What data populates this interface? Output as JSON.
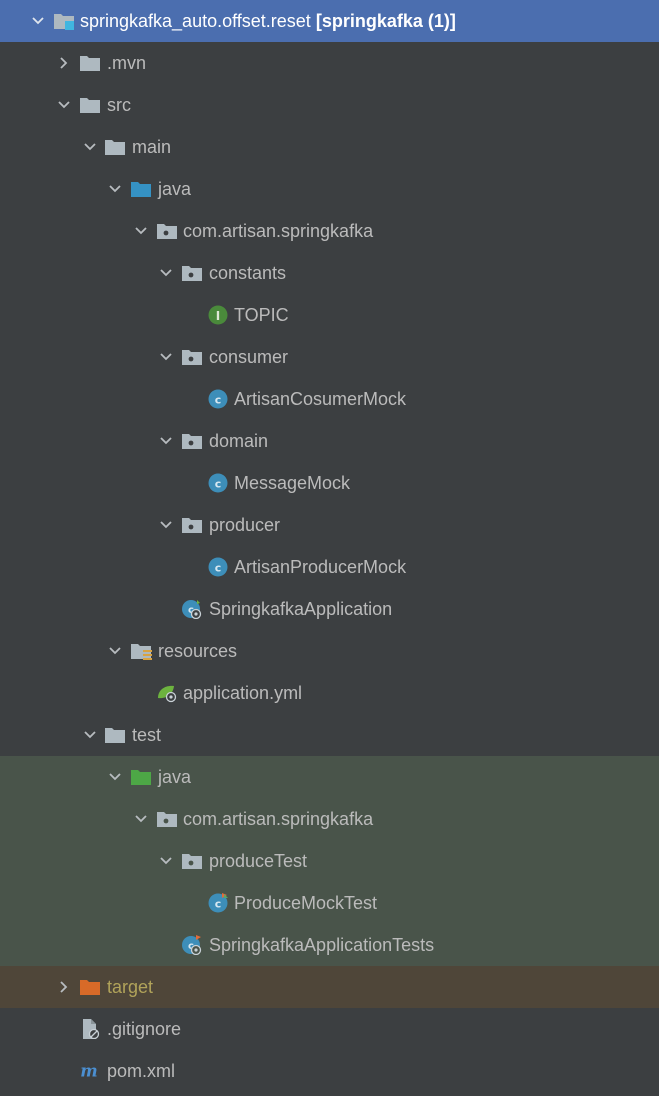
{
  "colors": {
    "selected_bg": "#4b6eaf",
    "panel_bg": "#3c3f41",
    "test_bg": "#49544a",
    "excluded_bg": "#4f4639",
    "folder_grey": "#aeb9c0",
    "folder_java_blue": "#3592c4",
    "folder_test_green": "#4da746",
    "folder_excluded_orange": "#d86a28",
    "class_icon": "#3d8eb9",
    "interface_icon": "#4a8a3b",
    "spring_green": "#6db33f",
    "maven_blue": "#4b8fd1"
  },
  "tree": {
    "root": {
      "name": "springkafka_auto.offset.reset",
      "suffix": "[springkafka (1)]",
      "icon": "module-folder-icon"
    },
    "mvn": {
      "name": ".mvn",
      "icon": "folder-icon"
    },
    "src": {
      "name": "src",
      "icon": "folder-icon"
    },
    "main": {
      "name": "main",
      "icon": "folder-icon"
    },
    "main_java": {
      "name": "java",
      "icon": "source-root-folder-icon"
    },
    "main_pkg": {
      "name": "com.artisan.springkafka",
      "icon": "package-icon"
    },
    "constants": {
      "name": "constants",
      "icon": "package-icon"
    },
    "topic": {
      "name": "TOPIC",
      "icon": "interface-icon"
    },
    "consumer": {
      "name": "consumer",
      "icon": "package-icon"
    },
    "consumer_class": {
      "name": "ArtisanCosumerMock",
      "icon": "class-icon"
    },
    "domain": {
      "name": "domain",
      "icon": "package-icon"
    },
    "domain_class": {
      "name": "MessageMock",
      "icon": "class-icon"
    },
    "producer": {
      "name": "producer",
      "icon": "package-icon"
    },
    "producer_class": {
      "name": "ArtisanProducerMock",
      "icon": "class-icon"
    },
    "app": {
      "name": "SpringkafkaApplication",
      "icon": "spring-boot-class-icon"
    },
    "resources": {
      "name": "resources",
      "icon": "resources-folder-icon"
    },
    "app_yml": {
      "name": "application.yml",
      "icon": "spring-config-icon"
    },
    "test": {
      "name": "test",
      "icon": "folder-icon"
    },
    "test_java": {
      "name": "java",
      "icon": "test-root-folder-icon"
    },
    "test_pkg": {
      "name": "com.artisan.springkafka",
      "icon": "package-icon"
    },
    "produce_test": {
      "name": "produceTest",
      "icon": "package-icon"
    },
    "produce_mock_test": {
      "name": "ProduceMockTest",
      "icon": "test-class-icon"
    },
    "app_tests": {
      "name": "SpringkafkaApplicationTests",
      "icon": "spring-boot-test-class-icon"
    },
    "target": {
      "name": "target",
      "icon": "excluded-folder-icon"
    },
    "gitignore": {
      "name": ".gitignore",
      "icon": "ignore-file-icon"
    },
    "pom": {
      "name": "pom.xml",
      "icon": "maven-icon"
    }
  }
}
